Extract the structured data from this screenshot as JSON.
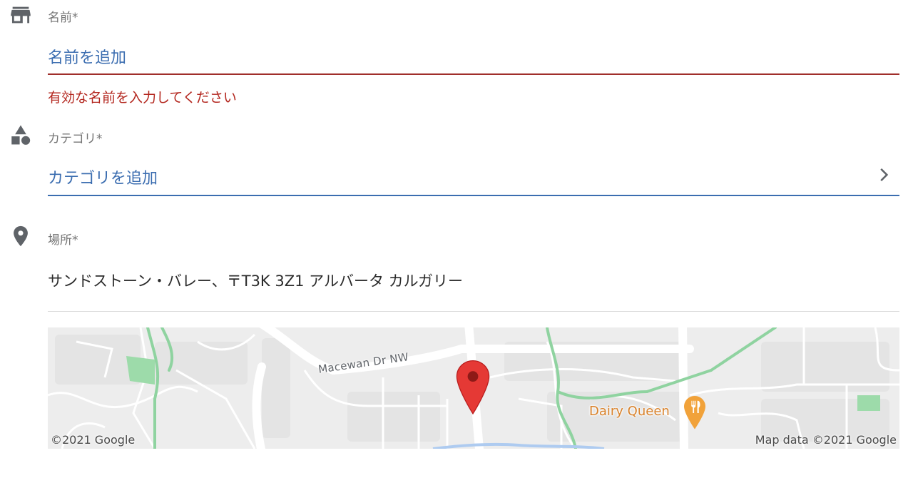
{
  "name_field": {
    "icon": "store-icon",
    "label": "名前*",
    "placeholder": "名前を追加",
    "value": "",
    "error": "有効な名前を入力してください",
    "underline_color": "#a02e2a"
  },
  "category_field": {
    "icon": "category-shapes-icon",
    "label": "カテゴリ*",
    "placeholder": "カテゴリを追加",
    "chevron_icon": "chevron-right-icon",
    "underline_color": "#3b6db0"
  },
  "location_field": {
    "icon": "location-pin-icon",
    "label": "場所*",
    "address": "サンドストーン・バレー、〒T3K 3Z1 アルバータ カルガリー"
  },
  "map": {
    "street_label": "Macewan Dr NW",
    "poi_label": "Dairy Queen",
    "poi_icon": "restaurant-icon",
    "marker_icon": "map-marker-icon",
    "copyright_left": "©2021 Google",
    "copyright_right": "Map data ©2021 Google",
    "colors": {
      "road": "#ffffff",
      "block": "#e6e6e6",
      "park": "#8fd3a0",
      "water": "#aecbf0",
      "marker": "#e53935",
      "poi": "#d9822b"
    }
  },
  "colors": {
    "accent_blue": "#3b6db0",
    "error_red": "#b3261e",
    "label_gray": "#757575",
    "icon_gray": "#5f6368"
  }
}
